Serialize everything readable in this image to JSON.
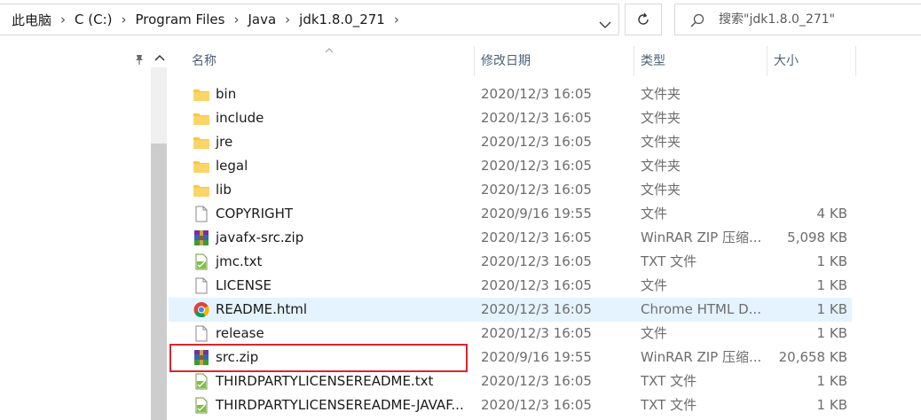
{
  "address_bar": {
    "crumbs": [
      "此电脑",
      "C (C:)",
      "Program Files",
      "Java",
      "jdk1.8.0_271"
    ]
  },
  "search": {
    "placeholder": "搜索\"jdk1.8.0_271\""
  },
  "columns": {
    "name": "名称",
    "modified": "修改日期",
    "type": "类型",
    "size": "大小"
  },
  "files": [
    {
      "name": "bin",
      "modified": "2020/12/3 16:05",
      "type": "文件夹",
      "size": "",
      "icon": "folder-icon"
    },
    {
      "name": "include",
      "modified": "2020/12/3 16:05",
      "type": "文件夹",
      "size": "",
      "icon": "folder-icon"
    },
    {
      "name": "jre",
      "modified": "2020/12/3 16:05",
      "type": "文件夹",
      "size": "",
      "icon": "folder-icon"
    },
    {
      "name": "legal",
      "modified": "2020/12/3 16:05",
      "type": "文件夹",
      "size": "",
      "icon": "folder-icon"
    },
    {
      "name": "lib",
      "modified": "2020/12/3 16:05",
      "type": "文件夹",
      "size": "",
      "icon": "folder-icon"
    },
    {
      "name": "COPYRIGHT",
      "modified": "2020/9/16 19:55",
      "type": "文件",
      "size": "4 KB",
      "icon": "file-icon"
    },
    {
      "name": "javafx-src.zip",
      "modified": "2020/12/3 16:05",
      "type": "WinRAR ZIP 压缩...",
      "size": "5,098 KB",
      "icon": "winrar-zip-icon"
    },
    {
      "name": "jmc.txt",
      "modified": "2020/12/3 16:05",
      "type": "TXT 文件",
      "size": "1 KB",
      "icon": "txt-file-icon"
    },
    {
      "name": "LICENSE",
      "modified": "2020/12/3 16:05",
      "type": "文件",
      "size": "1 KB",
      "icon": "file-icon"
    },
    {
      "name": "README.html",
      "modified": "2020/12/3 16:05",
      "type": "Chrome HTML D...",
      "size": "1 KB",
      "icon": "chrome-html-icon",
      "selected": true
    },
    {
      "name": "release",
      "modified": "2020/12/3 16:05",
      "type": "文件",
      "size": "1 KB",
      "icon": "file-icon"
    },
    {
      "name": "src.zip",
      "modified": "2020/9/16 19:55",
      "type": "WinRAR ZIP 压缩...",
      "size": "20,658 KB",
      "icon": "winrar-zip-icon"
    },
    {
      "name": "THIRDPARTYLICENSEREADME.txt",
      "modified": "2020/12/3 16:05",
      "type": "TXT 文件",
      "size": "1 KB",
      "icon": "txt-file-icon"
    },
    {
      "name": "THIRDPARTYLICENSEREADME-JAVAF...",
      "modified": "2020/12/3 16:05",
      "type": "TXT 文件",
      "size": "1 KB",
      "icon": "txt-file-icon"
    }
  ],
  "colors": {
    "selected_row": "#e5f3ff",
    "highlight_box": "#d9262c",
    "folder": "#f8c743"
  }
}
